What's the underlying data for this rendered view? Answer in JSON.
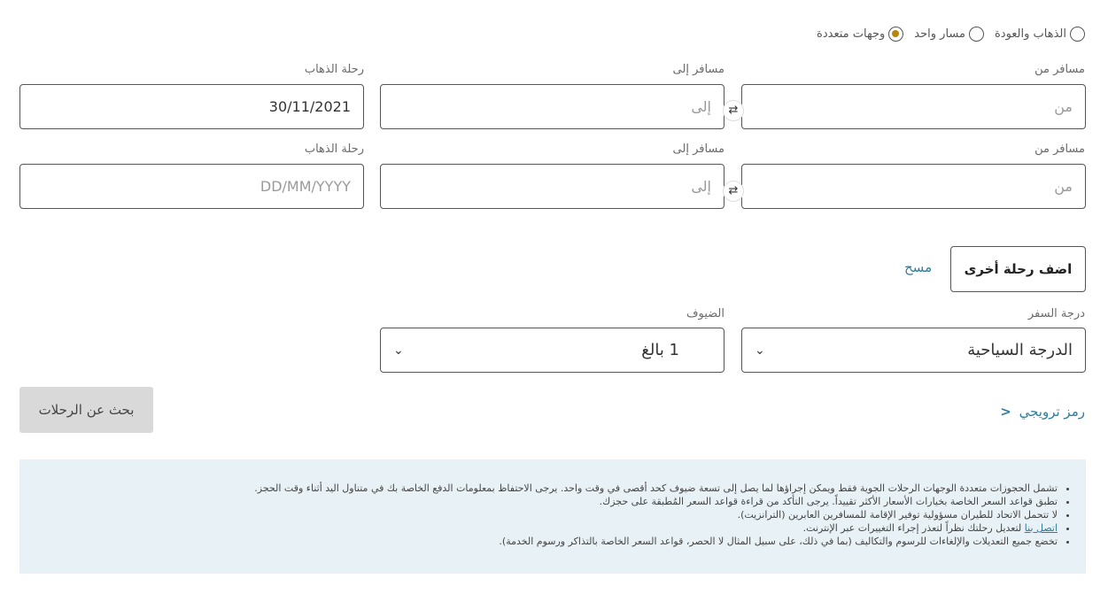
{
  "trip_type": {
    "options": [
      {
        "label": "الذهاب والعودة",
        "checked": false
      },
      {
        "label": "مسار واحد",
        "checked": false
      },
      {
        "label": "وجهات متعددة",
        "checked": true
      }
    ]
  },
  "legs": [
    {
      "from_label": "مسافر من",
      "from_placeholder": "من",
      "to_label": "مسافر إلى",
      "to_placeholder": "إلى",
      "date_label": "رحلة الذهاب",
      "date_value": "30/11/2021"
    },
    {
      "from_label": "مسافر من",
      "from_placeholder": "من",
      "to_label": "مسافر إلى",
      "to_placeholder": "إلى",
      "date_label": "رحلة الذهاب",
      "date_placeholder": "DD/MM/YYYY"
    }
  ],
  "swap_icon": "⇄",
  "add_flight_label": "اضف رحلة أخرى",
  "clear_label": "مسح",
  "cabin": {
    "label": "درجة السفر",
    "value": "الدرجة السياحية"
  },
  "guests": {
    "label": "الضيوف",
    "value": "1 بالغ"
  },
  "chevron_icon": "⌄",
  "promo_label": "رمز ترويجي",
  "promo_icon": "<",
  "search_label": "بحث عن الرحلات",
  "notices": [
    "تشمل الحجوزات متعددة الوجهات الرحلات الجوية فقط ويمكن إجراؤها لما يصل إلى تسعة ضيوف كحد أقصى في وقت واحد. يرجى الاحتفاظ بمعلومات الدفع الخاصة بك في متناول اليد أثناء وقت الحجز.",
    "تطبق قواعد السعر الخاصة بخيارات الأسعار الأكثر تقييداً. يرجى التأكد من قراءة قواعد السعر المُطبقة على حجزك.",
    "لا تتحمل الاتحاد للطيران مسؤولية توفير الإقامة للمسافرين العابرين (الترانزيت).",
    {
      "link": "اتصل بنا",
      "text": " لتعديل رحلتك نظراً لتعذر إجراء التغييرات عبر الإنترنت."
    },
    "تخضع جميع التعديلات والإلغاءات للرسوم والتكاليف (بما في ذلك، على سبيل المثال لا الحصر، قواعد السعر الخاصة بالتذاكر ورسوم الخدمة)."
  ]
}
